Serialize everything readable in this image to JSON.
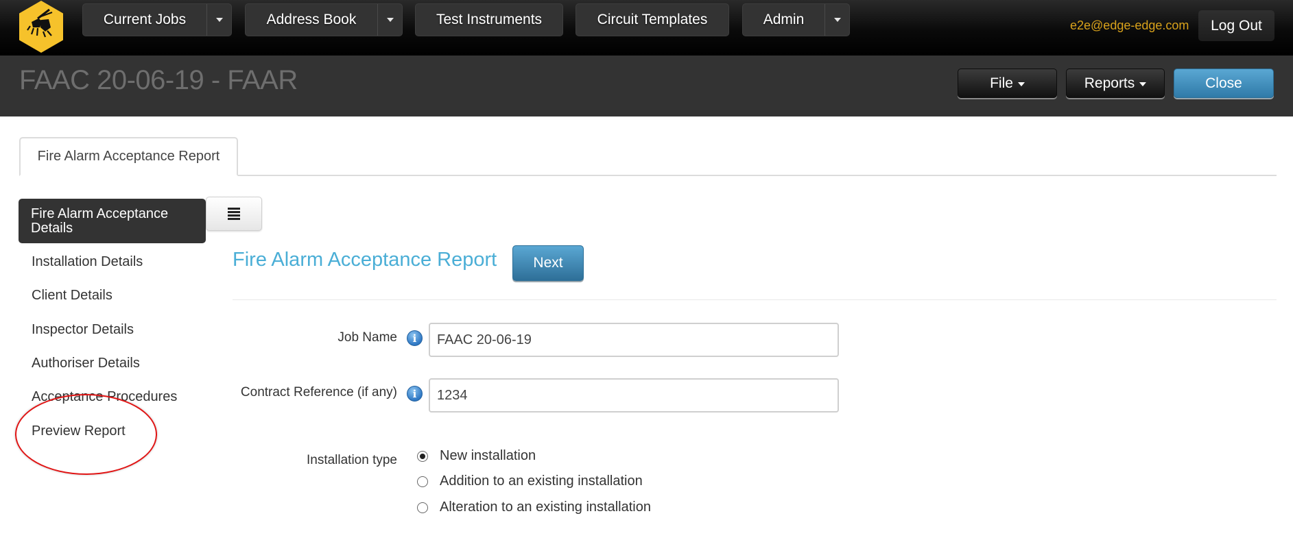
{
  "topnav": {
    "logo": "hornet-logo",
    "items": [
      {
        "label": "Current Jobs",
        "has_dropdown": true
      },
      {
        "label": "Address Book",
        "has_dropdown": true
      },
      {
        "label": "Test Instruments",
        "has_dropdown": false
      },
      {
        "label": "Circuit Templates",
        "has_dropdown": false
      },
      {
        "label": "Admin",
        "has_dropdown": true
      }
    ],
    "user_email": "e2e@edge-edge.com",
    "logout_label": "Log Out"
  },
  "header": {
    "title": "FAAC 20-06-19 - FAAR",
    "file_label": "File",
    "reports_label": "Reports",
    "close_label": "Close"
  },
  "tabs": [
    {
      "label": "Fire Alarm Acceptance Report",
      "active": true
    }
  ],
  "sidebar": {
    "items": [
      {
        "label": "Fire Alarm Acceptance Details",
        "active": true
      },
      {
        "label": "Installation Details"
      },
      {
        "label": "Client Details"
      },
      {
        "label": "Inspector Details"
      },
      {
        "label": "Authoriser Details"
      },
      {
        "label": "Acceptance Procedures"
      },
      {
        "label": "Preview Report",
        "annotated": true
      }
    ],
    "toggle_icon": "hamburger-icon"
  },
  "main": {
    "heading": "Fire Alarm Acceptance Report",
    "next_label": "Next",
    "fields": {
      "job_name": {
        "label": "Job Name",
        "value": "FAAC 20-06-19"
      },
      "contract_reference": {
        "label": "Contract Reference (if any)",
        "value": "1234"
      }
    },
    "installation_type": {
      "label": "Installation type",
      "options": [
        {
          "label": "New installation",
          "selected": true
        },
        {
          "label": "Addition to an existing installation",
          "selected": false
        },
        {
          "label": "Alteration to an existing installation",
          "selected": false
        }
      ]
    }
  },
  "colors": {
    "accent_blue": "#4aaed6",
    "button_blue": "#3a8fc0",
    "email_gold": "#d9a21b",
    "annotation_red": "#e01515",
    "logo_yellow": "#f6c22b"
  }
}
